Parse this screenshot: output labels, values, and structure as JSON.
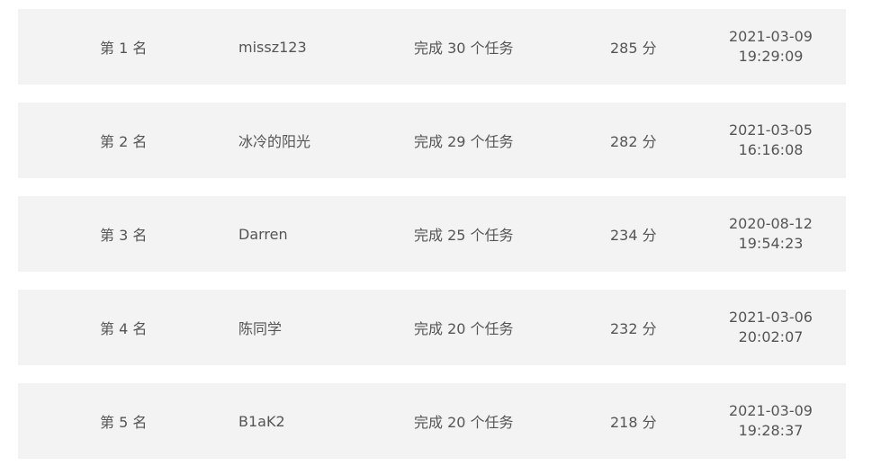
{
  "ranking": {
    "rows": [
      {
        "rank": "第 1 名",
        "user": "missz123",
        "tasks": "完成 30 个任务",
        "score": "285 分",
        "date": "2021-03-09",
        "time": "19:29:09"
      },
      {
        "rank": "第 2 名",
        "user": "冰冷的阳光",
        "tasks": "完成 29 个任务",
        "score": "282 分",
        "date": "2021-03-05",
        "time": "16:16:08"
      },
      {
        "rank": "第 3 名",
        "user": "Darren",
        "tasks": "完成 25 个任务",
        "score": "234 分",
        "date": "2020-08-12",
        "time": "19:54:23"
      },
      {
        "rank": "第 4 名",
        "user": "陈同学",
        "tasks": "完成 20 个任务",
        "score": "232 分",
        "date": "2021-03-06",
        "time": "20:02:07"
      },
      {
        "rank": "第 5 名",
        "user": "B1aK2",
        "tasks": "完成 20 个任务",
        "score": "218 分",
        "date": "2021-03-09",
        "time": "19:28:37"
      }
    ]
  },
  "colors": {
    "row_background": "#f3f3f3",
    "text": "#555555",
    "page_background": "#ffffff"
  }
}
